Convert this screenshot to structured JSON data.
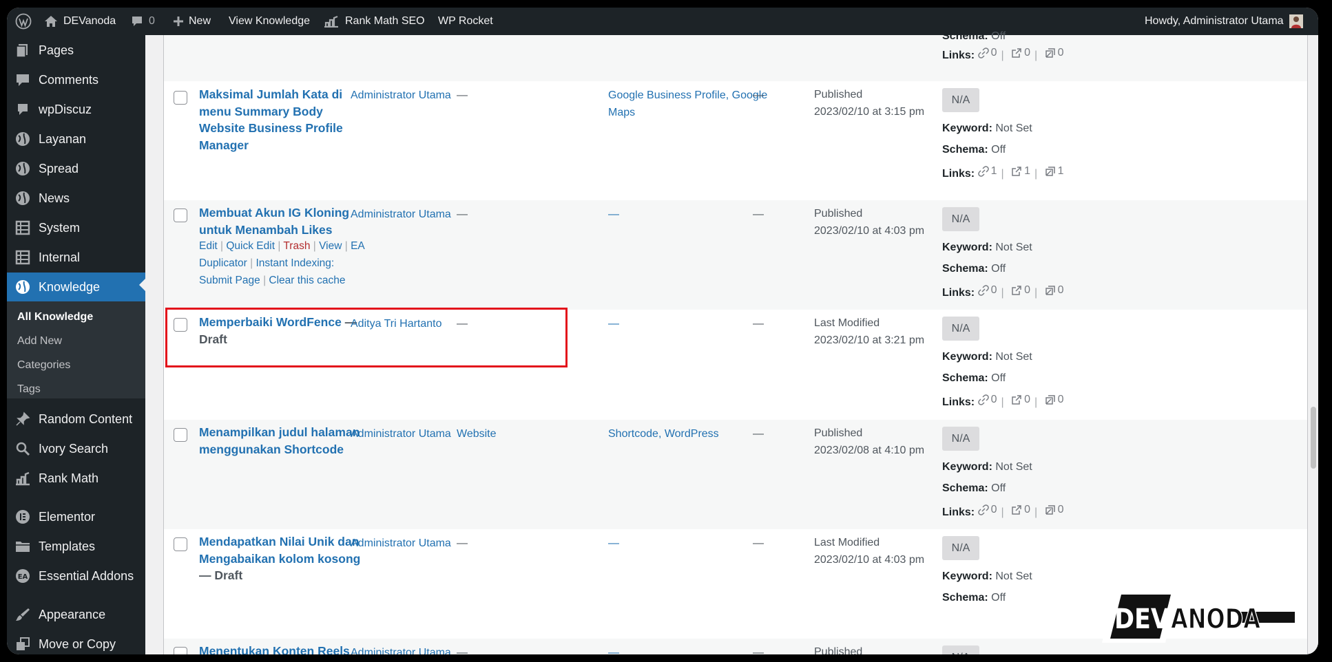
{
  "adminbar": {
    "site_name": "DEVanoda",
    "comments_count": "0",
    "new_label": "New",
    "view_label": "View Knowledge",
    "rankmath_label": "Rank Math SEO",
    "rocket_label": "WP Rocket",
    "howdy": "Howdy, Administrator Utama"
  },
  "sidebar": {
    "items": [
      {
        "label": "Pages",
        "icon": "pages-icon"
      },
      {
        "label": "Comments",
        "icon": "comments-icon"
      },
      {
        "label": "wpDiscuz",
        "icon": "wpdiscuz-icon"
      },
      {
        "label": "Layanan",
        "icon": "globe-icon"
      },
      {
        "label": "Spread",
        "icon": "globe-icon"
      },
      {
        "label": "News",
        "icon": "globe-icon"
      },
      {
        "label": "System",
        "icon": "film-icon"
      },
      {
        "label": "Internal",
        "icon": "film-icon"
      },
      {
        "label": "Knowledge",
        "icon": "globe-icon"
      }
    ],
    "submenu": [
      "All Knowledge",
      "Add New",
      "Categories",
      "Tags"
    ],
    "items2": [
      {
        "label": "Random Content",
        "icon": "pin-icon"
      },
      {
        "label": "Ivory Search",
        "icon": "search-icon"
      },
      {
        "label": "Rank Math",
        "icon": "rankmath-icon"
      },
      {
        "label": "Elementor",
        "icon": "elementor-icon"
      },
      {
        "label": "Templates",
        "icon": "folder-icon"
      },
      {
        "label": "Essential Addons",
        "icon": "ea-icon"
      },
      {
        "label": "Appearance",
        "icon": "brush-icon"
      },
      {
        "label": "Move or Copy",
        "icon": "move-icon"
      }
    ]
  },
  "seo_labels": {
    "keyword": "Keyword:",
    "schema": "Schema:",
    "links": "Links:",
    "na": "N/A"
  },
  "top_row": {
    "schema_value": "Off",
    "links": [
      "0",
      "0",
      "0"
    ]
  },
  "rows": [
    {
      "title": "Maksimal Jumlah Kata di menu Summary Body Website Business Profile Manager",
      "author": "Administrator Utama",
      "categories": "—",
      "tags": "Google Business Profile, Google Maps",
      "comments": "—",
      "status": "Published",
      "date": "2023/02/10 at 3:15 pm",
      "keyword": "Not Set",
      "schema": "Off",
      "links": [
        "1",
        "1",
        "1"
      ]
    },
    {
      "title": "Membuat Akun IG Kloning untuk Menambah Likes",
      "author": "Administrator Utama",
      "categories": "—",
      "tags": "—",
      "comments": "—",
      "status": "Published",
      "date": "2023/02/10 at 4:03 pm",
      "keyword": "Not Set",
      "schema": "Off",
      "links": [
        "0",
        "0",
        "0"
      ],
      "actions": {
        "edit": "Edit",
        "quick_edit": "Quick Edit",
        "trash": "Trash",
        "view": "View",
        "ea": "EA",
        "duplicator": "Duplicator",
        "instant_indexing": "Instant Indexing:",
        "submit_page": "Submit Page",
        "clear_cache": "Clear this cache"
      }
    },
    {
      "title": "Memperbaiki WordFence",
      "draft": "— Draft",
      "author": "Aditya Tri Hartanto",
      "categories": "—",
      "tags": "—",
      "comments": "—",
      "status": "Last Modified",
      "date": "2023/02/10 at 3:21 pm",
      "keyword": "Not Set",
      "schema": "Off",
      "links": [
        "0",
        "0",
        "0"
      ]
    },
    {
      "title": "Menampilkan judul halaman menggunakan Shortcode",
      "author": "Administrator Utama",
      "categories": "Website",
      "tags": "Shortcode, WordPress",
      "comments": "—",
      "status": "Published",
      "date": "2023/02/08 at 4:10 pm",
      "keyword": "Not Set",
      "schema": "Off",
      "links": [
        "0",
        "0",
        "0"
      ]
    },
    {
      "title": "Mendapatkan Nilai Unik dan Mengabaikan kolom kosong",
      "draft": "— Draft",
      "author": "Administrator Utama",
      "categories": "—",
      "tags": "—",
      "comments": "—",
      "status": "Last Modified",
      "date": "2023/02/10 at 4:03 pm",
      "keyword": "Not Set",
      "schema": "Off"
    },
    {
      "title": "Menentukan Konten Reels",
      "author": "Administrator Utama",
      "categories": "—",
      "tags": "—",
      "comments": "—",
      "status": "Published"
    }
  ],
  "watermark": "DEVANODA",
  "colors": {
    "admin_bar": "#1d2327",
    "accent": "#2271b1",
    "highlight": "#e3121b",
    "trash": "#b32d2e"
  }
}
